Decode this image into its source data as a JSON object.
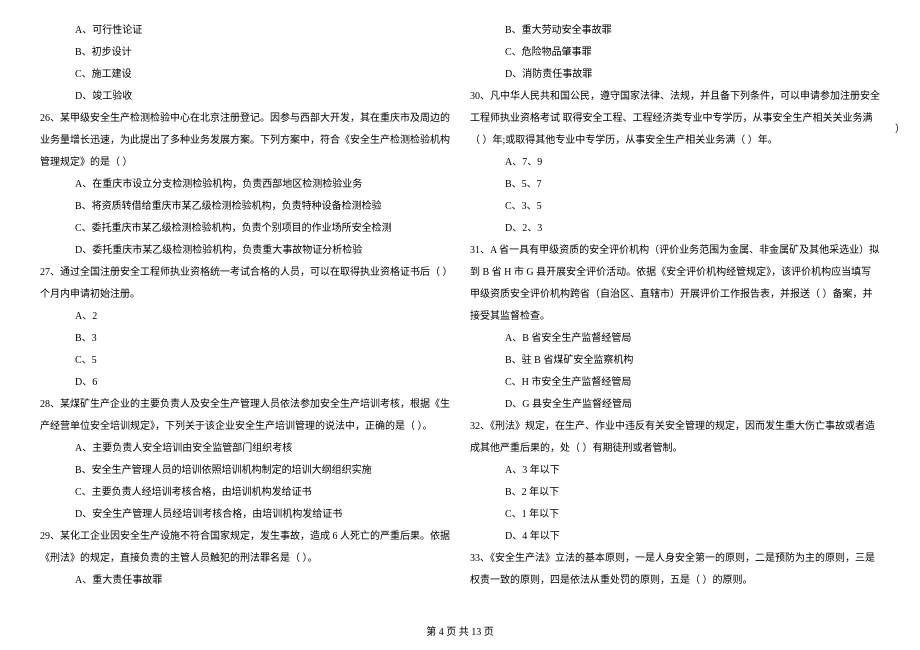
{
  "left": {
    "q25_options": {
      "a": "A、可行性论证",
      "b": "B、初步设计",
      "c": "C、施工建设",
      "d": "D、竣工验收"
    },
    "q26": {
      "stem": "26、某甲级安全生产检测检验中心在北京注册登记。因参与西部大开发，其在重庆市及周边的业务量增长迅速，为此提出了多种业务发展方案。下列方案中，符合《安全生产检测检验机构管理规定》的是（    ）",
      "a": "A、在重庆市设立分支检测检验机构，负责西部地区检测检验业务",
      "b": "B、将资质转借给重庆市某乙级检测检验机构，负责特种设备检测检验",
      "c": "C、委托重庆市某乙级检测检验机构，负责个别项目的作业场所安全检测",
      "d": "D、委托重庆市某乙级检测检验机构，负责重大事故物证分析检验"
    },
    "q27": {
      "stem": "27、通过全国注册安全工程师执业资格统一考试合格的人员，可以在取得执业资格证书后（    ）个月内申请初始注册。",
      "a": "A、2",
      "b": "B、3",
      "c": "C、5",
      "d": "D、6"
    },
    "q28": {
      "stem": "28、某煤矿生产企业的主要负责人及安全生产管理人员依法参加安全生产培训考核，根据《生产经营单位安全培训规定》，下列关于该企业安全生产培训管理的说法中，正确的是（    ）。",
      "a": "A、主要负责人安全培训由安全监管部门组织考核",
      "b": "B、安全生产管理人员的培训依照培训机构制定的培训大纲组织实施",
      "c": "C、主要负责人经培训考核合格，由培训机构发给证书",
      "d": "D、安全生产管理人员经培训考核合格，由培训机构发给证书"
    },
    "q29": {
      "stem": "29、某化工企业因安全生产设施不符合国家规定，发生事故，造成 6 人死亡的严重后果。依据《刑法》的规定，直接负责的主管人员触犯的刑法罪名是（    ）。",
      "a": "A、重大责任事故罪"
    }
  },
  "right": {
    "q29_options": {
      "b": "B、重大劳动安全事故罪",
      "c": "C、危险物品肇事罪",
      "d": "D、消防责任事故罪"
    },
    "q30": {
      "stem": "30、凡中华人民共和国公民，遵守国家法律、法规，并且备下列条件，可以申请参加注册安全工程师执业资格考试 取得安全工程、工程经济类专业中专学历，从事安全生产相关关业务满（    ）年;或取得其他专业中专学历，从事安全生产相关业务满（    ）年。",
      "a": "A、7、9",
      "b": "B、5、7",
      "c": "C、3、5",
      "d": "D、2、3"
    },
    "q31": {
      "stem": "31、A 省一具有甲级资质的安全评价机构（评价业务范围为金属、非金属矿及其他采选业）拟到 B 省 H 市 G 县开展安全评价活动。依据《安全评价机构经管规定》，该评价机构应当填写甲级资质安全评价机构跨省（自治区、直辖市）开展评价工作报告表，并报送（    ）备案，并接受其监督检查。",
      "a": "A、B 省安全生产监督经管局",
      "b": "B、驻 B 省煤矿安全监察机构",
      "c": "C、H 市安全生产监督经管局",
      "d": "D、G 县安全生产监督经管局"
    },
    "q32": {
      "stem": "32、《刑法》规定，在生产、作业中违反有关安全管理的规定，因而发生重大伤亡事故或者造成其他严重后果的，处（    ）有期徒刑或者管制。",
      "a": "A、3 年以下",
      "b": "B、2 年以下",
      "c": "C、1 年以下",
      "d": "D、4 年以下"
    },
    "q33": {
      "stem": "33、《安全生产法》立法的基本原则，一是人身安全第一的原则，二是预防为主的原则，三是权责一致的原则，四是依法从重处罚的原则，五是（    ）的原则。"
    },
    "right_mark": "）"
  },
  "footer": "第 4 页 共 13 页"
}
